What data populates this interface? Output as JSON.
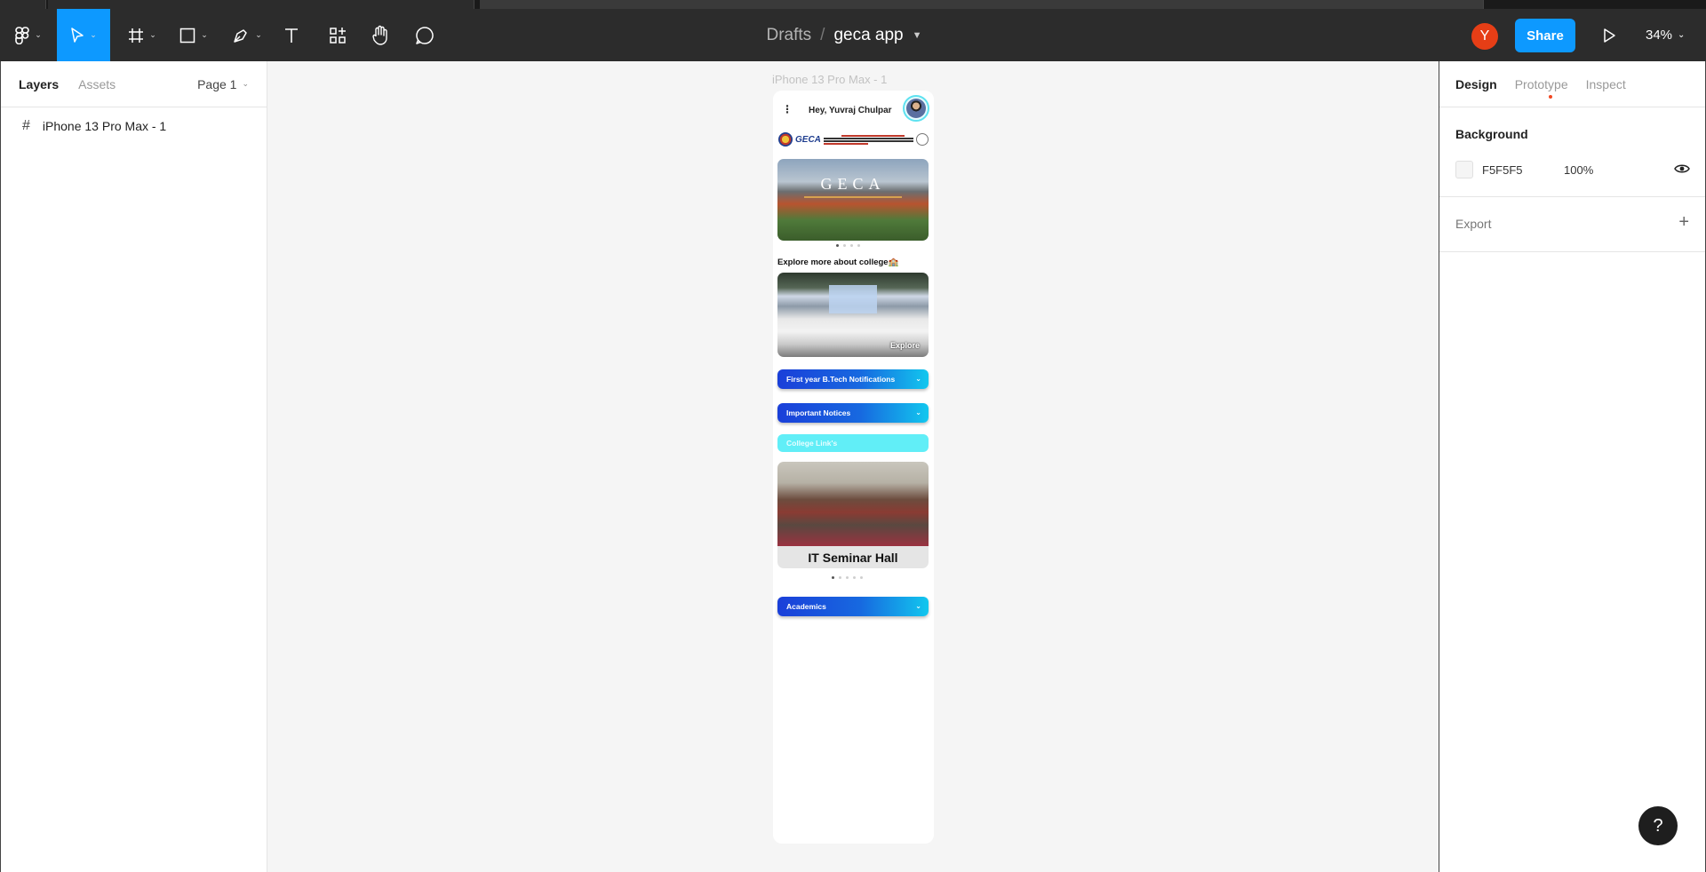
{
  "app": {
    "breadcrumb_root": "Drafts",
    "breadcrumb_separator": "/",
    "file_name": "geca app",
    "user_initial": "Y",
    "share_label": "Share",
    "zoom_level": "34%",
    "accent_color": "#0d99ff"
  },
  "toolbar": {
    "tools": [
      "main-menu-icon",
      "move-icon",
      "frame-icon",
      "rectangle-icon",
      "pen-icon",
      "text-icon",
      "resources-icon",
      "hand-icon",
      "comment-icon"
    ]
  },
  "left_panel": {
    "tab_layers": "Layers",
    "tab_assets": "Assets",
    "page_selector": "Page 1",
    "layers": [
      {
        "icon": "frame-icon",
        "label": "iPhone 13 Pro Max - 1"
      }
    ]
  },
  "canvas": {
    "frame_label": "iPhone 13 Pro Max - 1",
    "background_color": "#f5f5f5"
  },
  "phone": {
    "greeting": "Hey, Yuvraj Chulpar",
    "logo_text": "GECA",
    "hero_title": "GECA",
    "hero_carousel": {
      "count": 4,
      "active_index": 0
    },
    "explore_heading": "Explore more about college🏫",
    "explore_label": "Explore",
    "sections": [
      {
        "label": "First year B.Tech Notifications"
      },
      {
        "label": "Important Notices"
      },
      {
        "label": "College Link's"
      },
      {
        "label": "Academics"
      }
    ],
    "seminar_caption": "IT Seminar Hall",
    "seminar_carousel": {
      "count": 5,
      "active_index": 0
    }
  },
  "right_panel": {
    "tab_design": "Design",
    "tab_prototype": "Prototype",
    "tab_inspect": "Inspect",
    "background_title": "Background",
    "background_hex": "F5F5F5",
    "background_opacity": "100%",
    "export_title": "Export",
    "export_add": "+"
  },
  "help": {
    "label": "?"
  }
}
